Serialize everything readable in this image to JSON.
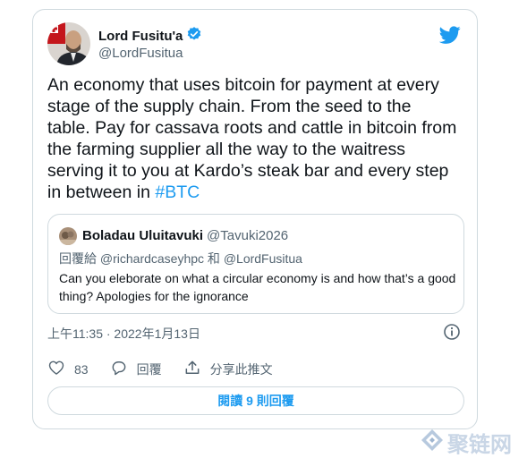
{
  "tweet": {
    "author_name": "Lord Fusitu'a",
    "author_handle": "@LordFusitua",
    "body": "An economy that uses bitcoin for payment at every\nstage of the supply chain. From the seed to the\ntable. Pay for cassava roots and cattle in bitcoin from\nthe farming supplier all the way to the waitress\nserving it to you at Kardo’s steak bar and every step\nin between in ",
    "hashtag": "#BTC",
    "timestamp": "上午11:35 · 2022年1月13日"
  },
  "quote": {
    "author_name": "Boladau Uluitavuki",
    "author_handle": "@Tavuki2026",
    "reply_to": "回覆給 @richardcaseyhpc 和 @LordFusitua",
    "text": "Can you eleborate on what a circular economy is and how that’s a good thing? Apologies for the ignorance"
  },
  "actions": {
    "like_count": "83",
    "reply_label": "回覆",
    "share_label": "分享此推文"
  },
  "read_replies_label": "閱讀 9 則回覆",
  "watermark_text": "聚链网",
  "icons": {
    "verified": "verified-badge-icon",
    "logo": "twitter-bird-icon",
    "info": "info-icon",
    "like": "heart-icon",
    "reply": "reply-bubble-icon",
    "share": "share-upload-icon"
  },
  "colors": {
    "accent": "#1d9bf0",
    "secondary_text": "#536471",
    "border": "#cfd9de"
  }
}
